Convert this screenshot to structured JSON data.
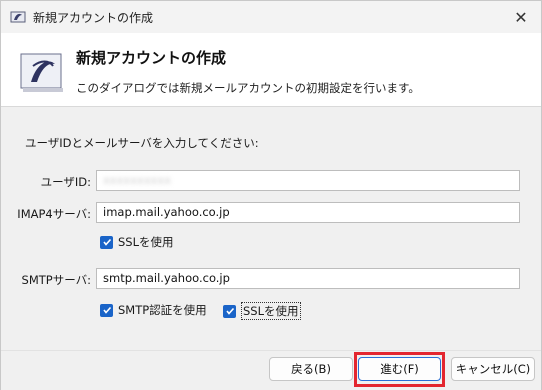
{
  "window": {
    "title": "新規アカウントの作成"
  },
  "header": {
    "title": "新規アカウントの作成",
    "description": "このダイアログでは新規メールアカウントの初期設定を行います。"
  },
  "form": {
    "instruction": "ユーザIDとメールサーバを入力してください:",
    "user_id": {
      "label": "ユーザID:",
      "value": "xxxxxxxxxx"
    },
    "imap": {
      "label": "IMAP4サーバ:",
      "value": "imap.mail.yahoo.co.jp",
      "ssl_label": "SSLを使用",
      "ssl_checked": true
    },
    "smtp": {
      "label": "SMTPサーバ:",
      "value": "smtp.mail.yahoo.co.jp",
      "auth_label": "SMTP認証を使用",
      "auth_checked": true,
      "ssl_label": "SSLを使用",
      "ssl_checked": true
    }
  },
  "buttons": {
    "back": "戻る(B)",
    "next": "進む(F)",
    "cancel": "キャンセル(C)"
  },
  "colors": {
    "checkbox": "#1a64c8",
    "highlight": "#e3262f"
  }
}
